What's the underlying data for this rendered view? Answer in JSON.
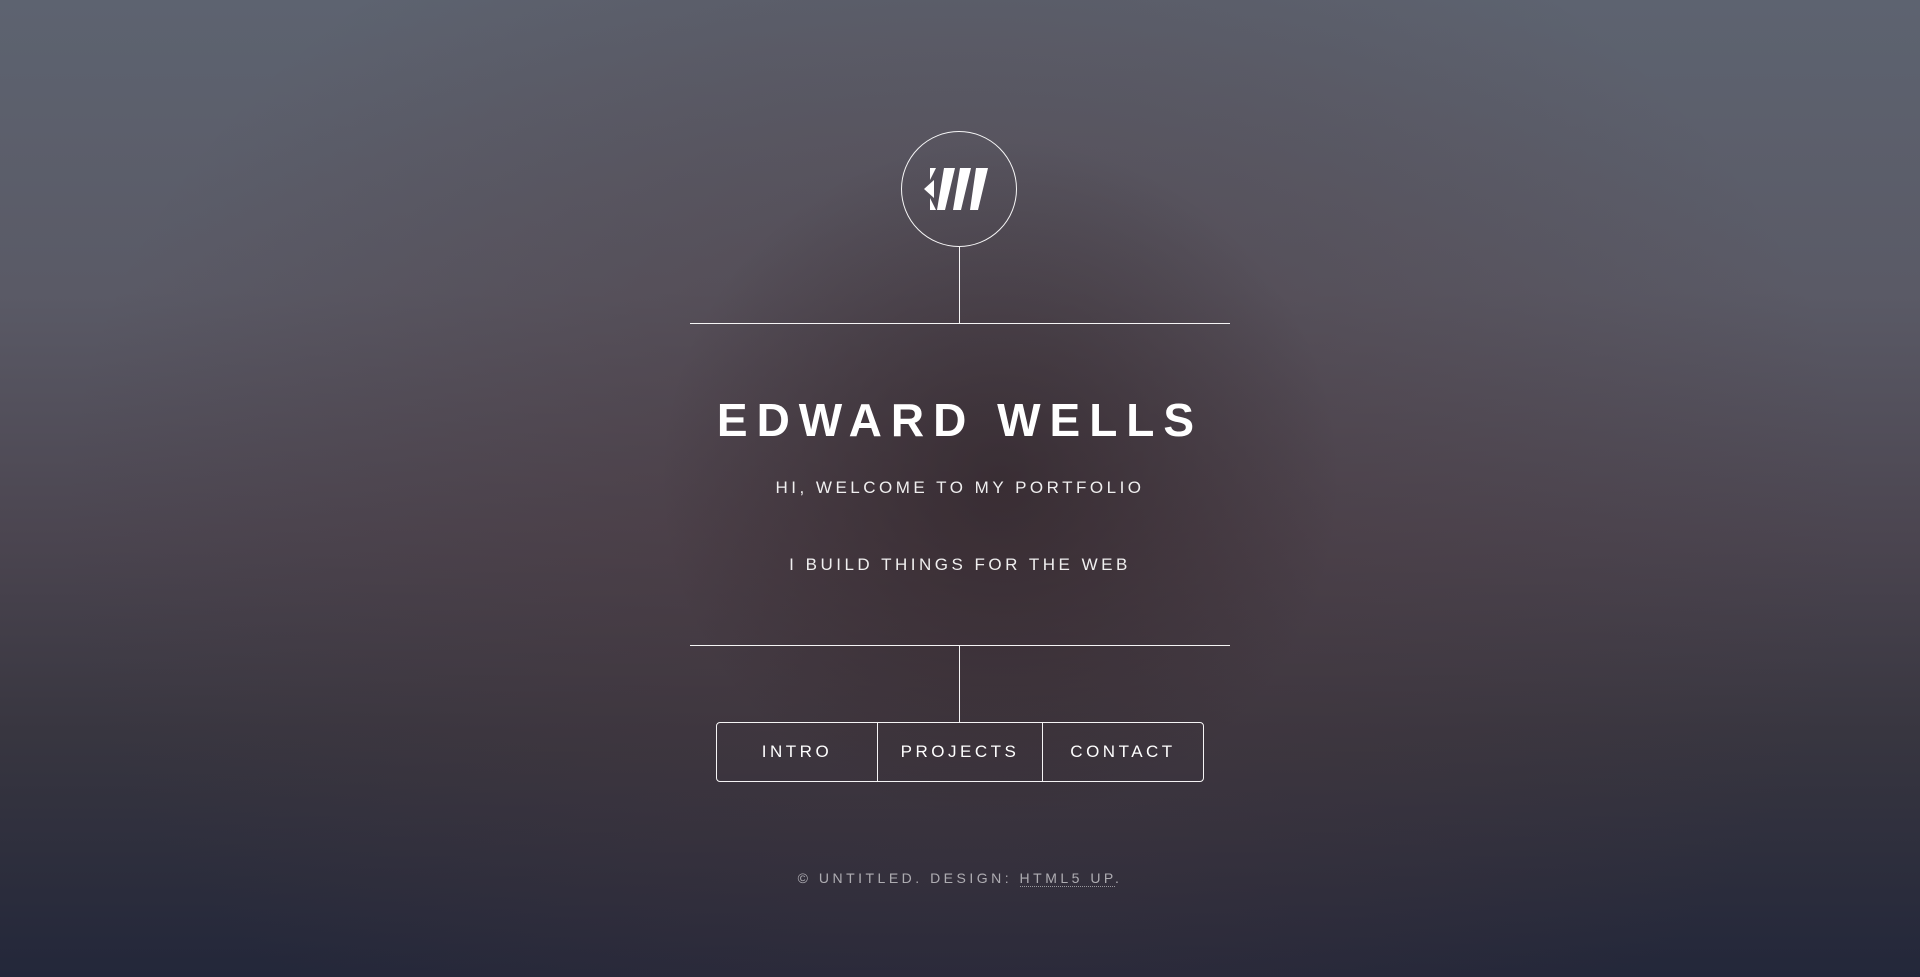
{
  "header": {
    "logo_icon": "monogram-ew-icon",
    "name": "EDWARD WELLS",
    "greeting": "HI, WELCOME TO MY PORTFOLIO",
    "subtitle": "I BUILD THINGS FOR THE WEB"
  },
  "nav": {
    "items": [
      {
        "label": "INTRO"
      },
      {
        "label": "PROJECTS"
      },
      {
        "label": "CONTACT"
      }
    ]
  },
  "footer": {
    "prefix": "© UNTITLED. DESIGN: ",
    "link_label": "HTML5 UP",
    "suffix": "."
  },
  "colors": {
    "text": "#ffffff",
    "line": "#ffffff",
    "background_top": "#5d6370",
    "background_bottom": "#23273a"
  }
}
